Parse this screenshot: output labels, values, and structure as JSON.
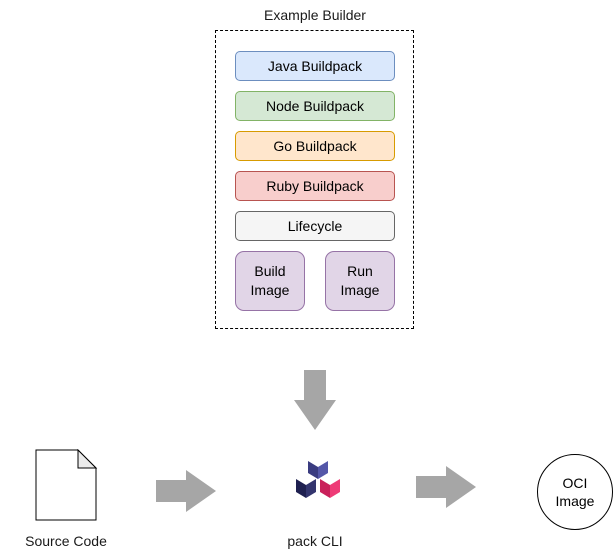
{
  "builder": {
    "title": "Example Builder",
    "buildpacks": [
      {
        "label": "Java Buildpack",
        "fill": "#dae8fc",
        "stroke": "#6c8ebf"
      },
      {
        "label": "Node Buildpack",
        "fill": "#d5e8d4",
        "stroke": "#82b366"
      },
      {
        "label": "Go Buildpack",
        "fill": "#ffe6cc",
        "stroke": "#d79b00"
      },
      {
        "label": "Ruby Buildpack",
        "fill": "#f8cecc",
        "stroke": "#b85450"
      }
    ],
    "lifecycle": {
      "label": "Lifecycle",
      "fill": "#f5f5f5",
      "stroke": "#666666"
    },
    "images": [
      {
        "line1": "Build",
        "line2": "Image"
      },
      {
        "line1": "Run",
        "line2": "Image"
      }
    ]
  },
  "flow": {
    "source": {
      "label": "Source Code",
      "icon": "document-icon"
    },
    "tool": {
      "label": "pack CLI",
      "icon": "buildpacks-logo-icon"
    },
    "output": {
      "line1": "OCI",
      "line2": "Image"
    }
  },
  "colors": {
    "arrow": "#a6a6a6",
    "logo_dark": "#2b2d5c",
    "logo_mid": "#4b4e9e",
    "logo_pink": "#e8336b"
  }
}
